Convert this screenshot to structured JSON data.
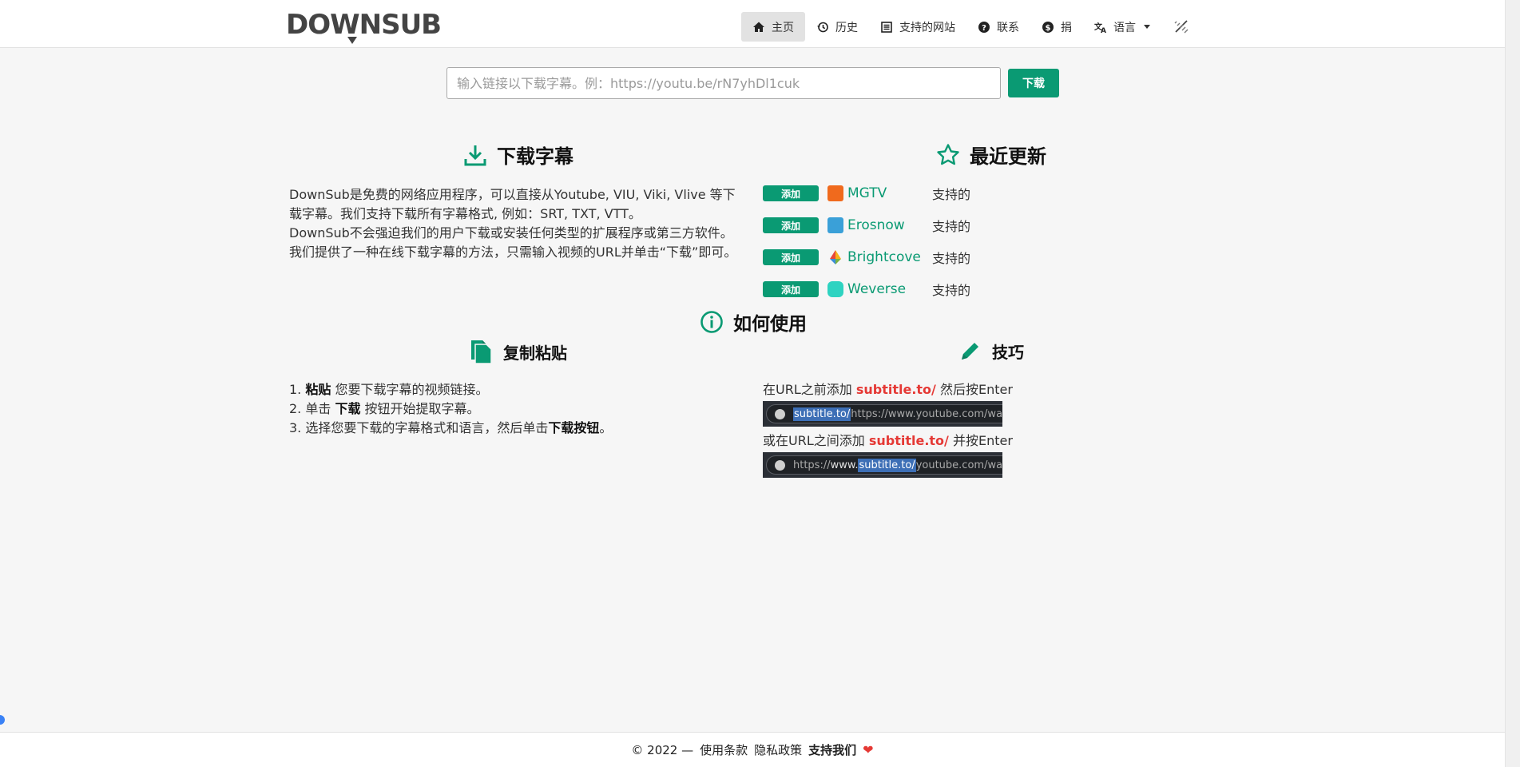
{
  "header": {
    "logo_text": "DOWNSUB",
    "nav": [
      {
        "label": "主页",
        "icon": "home-icon",
        "active": true
      },
      {
        "label": "历史",
        "icon": "history-icon"
      },
      {
        "label": "支持的网站",
        "icon": "list-icon"
      },
      {
        "label": "联系",
        "icon": "question-icon"
      },
      {
        "label": "捐",
        "icon": "dollar-icon"
      },
      {
        "label": "语言",
        "icon": "translate-icon"
      }
    ]
  },
  "search": {
    "placeholder": "输入链接以下载字幕。例：https://youtu.be/rN7yhDl1cuk",
    "button_label": "下载"
  },
  "about": {
    "title": "下载字幕",
    "paragraph_1": "DownSub是免费的网络应用程序，可以直接从Youtube, VIU, Viki, Vlive 等下载字幕。我们支持下载所有字幕格式, 例如：SRT, TXT, VTT。",
    "paragraph_2": "DownSub不会强迫我们的用户下载或安装任何类型的扩展程序或第三方软件。我们提供了一种在线下载字幕的方法，只需输入视频的URL并单击“下载”即可。"
  },
  "updates": {
    "title": "最近更新",
    "items": [
      {
        "badge": "添加",
        "name": "MGTV",
        "status": "支持的",
        "color": "#f06a1d"
      },
      {
        "badge": "添加",
        "name": "Erosnow",
        "status": "支持的",
        "color": "#3aa0d8"
      },
      {
        "badge": "添加",
        "name": "Brightcove",
        "status": "支持的",
        "color": "#7bb242"
      },
      {
        "badge": "添加",
        "name": "Weverse",
        "status": "支持的",
        "color": "#2ed3c1"
      }
    ]
  },
  "how_to": {
    "title": "如何使用",
    "copy_paste_title": "复制粘贴",
    "steps": [
      {
        "num": "1.",
        "bold": "粘贴",
        "text": " 您要下载字幕的视频链接。"
      },
      {
        "num": "2.",
        "pre": "单击 ",
        "bold": "下载",
        "text": " 按钮开始提取字幕。"
      },
      {
        "num": "3.",
        "text": "选择您要下载的字幕格式和语言，然后单击",
        "bold": "下载按钮",
        "post": "。"
      }
    ],
    "tips_title": "技巧",
    "tips": {
      "line_1_pre": "在URL之前添加 ",
      "line_1_highlight": "subtitle.to/",
      "line_1_post": " 然后按Enter",
      "img_1_hl": "subtitle.to/",
      "img_1_rest": "https://www.youtube.com/watch?v=",
      "line_2_pre": "或在URL之间添加 ",
      "line_2_highlight": "subtitle.to/",
      "line_2_post": " 并按Enter",
      "img_2_pre": "https://",
      "img_2_www": "www.",
      "img_2_hl": "subtitle.to/",
      "img_2_rest": "youtube.com/watch?v="
    }
  },
  "footer": {
    "copyright": "© 2022 —",
    "terms": "使用条款",
    "privacy": "隐私政策",
    "support": "支持我们"
  },
  "colors": {
    "accent": "#0a9a73",
    "highlight_red": "#e53935"
  }
}
